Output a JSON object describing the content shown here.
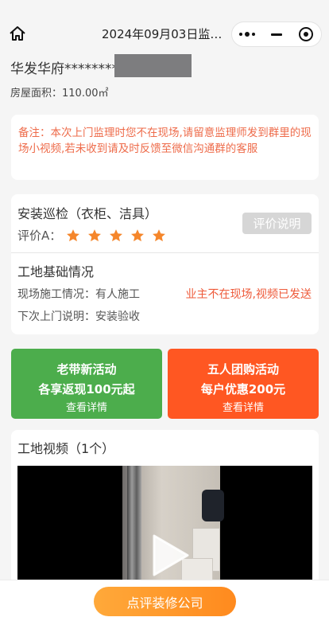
{
  "nav": {
    "title": "2024年09月03日监理...",
    "icons": [
      "home-icon",
      "more-icon",
      "minimize-icon",
      "close-target-icon"
    ]
  },
  "header": {
    "address": "华发华府********",
    "area": "房屋面积：110.00㎡"
  },
  "note": {
    "text": "备注：本次上门监理时您不在现场,请留意监理师发到群里的现场小视频,若未收到请及时反馈至微信沟通群的客服"
  },
  "inspection": {
    "title": "安装巡检（衣柜、洁具）",
    "rating_label": "评价A：",
    "rating_stars": 5,
    "rating_max": 5,
    "star_color": "#f5862b",
    "eval_button": "评价说明",
    "site_title": "工地基础情况",
    "construction": "现场施工情况：有人施工",
    "status": "业主不在现场,视频已发送",
    "next_visit": "下次上门说明：安装验收"
  },
  "promos": [
    {
      "line1": "老带新活动",
      "line2": "各享返现100元起",
      "line3": "查看详情",
      "color": "#4cad4c"
    },
    {
      "line1": "五人团购活动",
      "line2": "每户优惠200元",
      "line3": "查看详情",
      "color": "#ff5722"
    }
  ],
  "video": {
    "title": "工地视频（1个）"
  },
  "bottom": {
    "button": "点评装修公司",
    "accent": "#ff9a2e"
  }
}
